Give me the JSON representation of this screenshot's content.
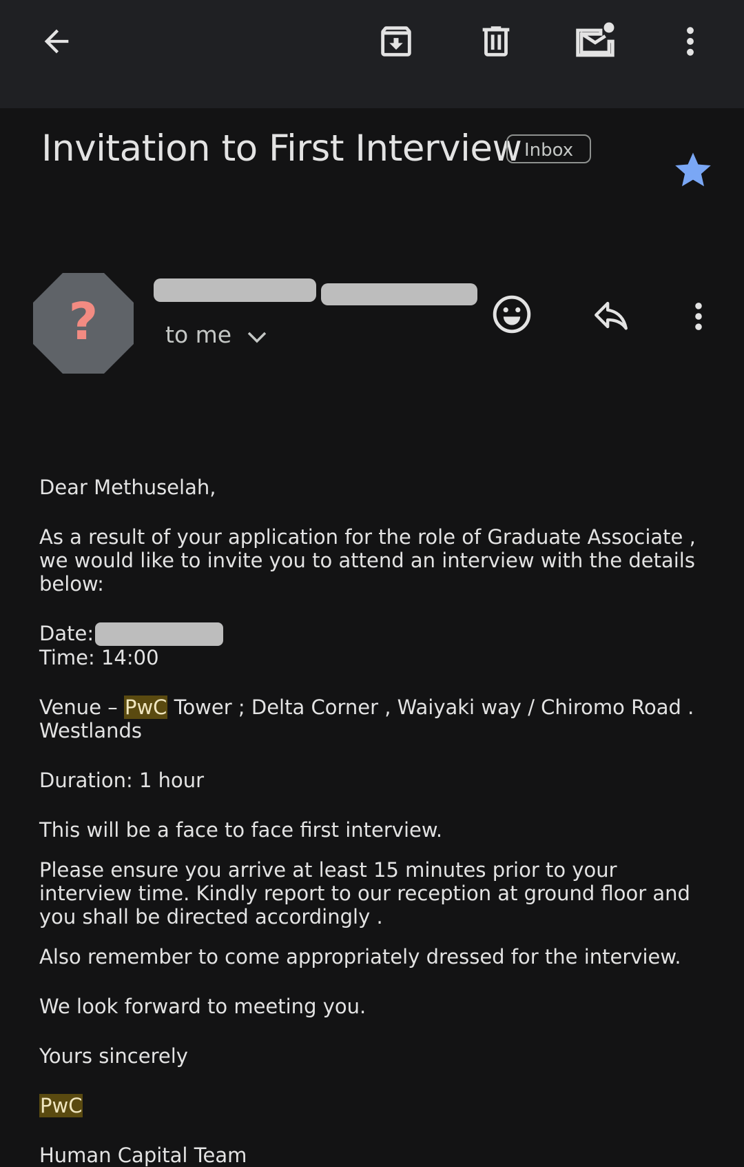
{
  "toolbar": {
    "back_icon": "arrow-back-icon",
    "archive_icon": "archive-icon",
    "delete_icon": "delete-icon",
    "mark_unread_icon": "mark-unread-icon",
    "more_icon": "more-vert-icon"
  },
  "email": {
    "subject": "Invitation to First Interview",
    "label": "Inbox",
    "starred": true,
    "star_color": "#7aa7f5",
    "avatar_symbol": "?",
    "avatar_color": "#5f6368",
    "avatar_symbol_color": "#f28b82",
    "recipient": "to me"
  },
  "body": {
    "greeting": "Dear Methuselah,",
    "intro": "As a result of your application for the role of Graduate Associate , we would like to invite you to attend an interview with the details below:",
    "date_label": "Date:",
    "time": "Time: 14:00",
    "venue_prefix": "Venue – ",
    "venue_highlight": "PwC",
    "venue_rest": " Tower ; Delta Corner , Waiyaki way / Chiromo Road . Westlands",
    "duration": "Duration: 1 hour",
    "format": "This will be a face to face first interview.",
    "arrival": "Please ensure you arrive at least 15 minutes prior to your interview time. Kindly report to our reception at ground floor and you shall be directed accordingly .",
    "dress": "Also remember to come appropriately dressed for the interview.",
    "closing": "We look forward to meeting you.",
    "signoff": "Yours sincerely",
    "company": "PwC",
    "team": "Human Capital Team"
  }
}
